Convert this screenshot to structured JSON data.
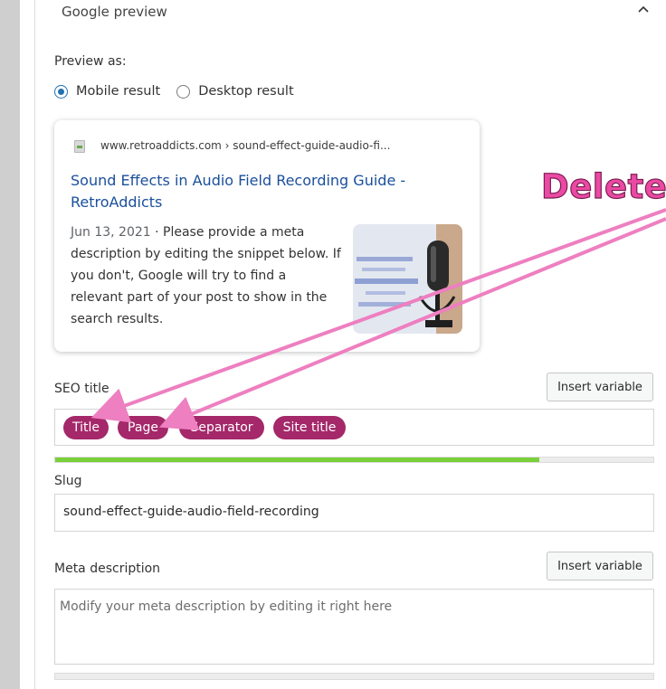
{
  "panel": {
    "title": "Google preview"
  },
  "preview_as": {
    "label": "Preview as:",
    "options": [
      {
        "label": "Mobile result",
        "selected": true
      },
      {
        "label": "Desktop result",
        "selected": false
      }
    ]
  },
  "search_result": {
    "url": "www.retroaddicts.com › sound-effect-guide-audio-fi...",
    "title": "Sound Effects in Audio Field Recording Guide - RetroAddicts",
    "date": "Jun 13, 2021",
    "separator": " · ",
    "snippet": "Please provide a meta description by editing the snippet below. If you don't, Google will try to find a relevant part of your post to show in the search results."
  },
  "seo_title": {
    "label": "SEO title",
    "insert_button": "Insert variable",
    "variables": [
      "Title",
      "Page",
      "Separator",
      "Site title"
    ],
    "progress_percent": 81
  },
  "slug": {
    "label": "Slug",
    "value": "sound-effect-guide-audio-field-recording"
  },
  "meta_description": {
    "label": "Meta description",
    "insert_button": "Insert variable",
    "placeholder": "Modify your meta description by editing it right here"
  },
  "annotation": {
    "text": "Delete"
  },
  "colors": {
    "link_blue": "#1a4f9c",
    "pill_purple": "#a4286a",
    "progress_green": "#7ad03a",
    "radio_blue": "#2271b1",
    "annotation_pink": "#ea4aa3"
  },
  "icons": {
    "collapse": "chevron-up-icon",
    "favicon": "site-favicon-icon",
    "thumbnail": "microphone-thumbnail"
  }
}
